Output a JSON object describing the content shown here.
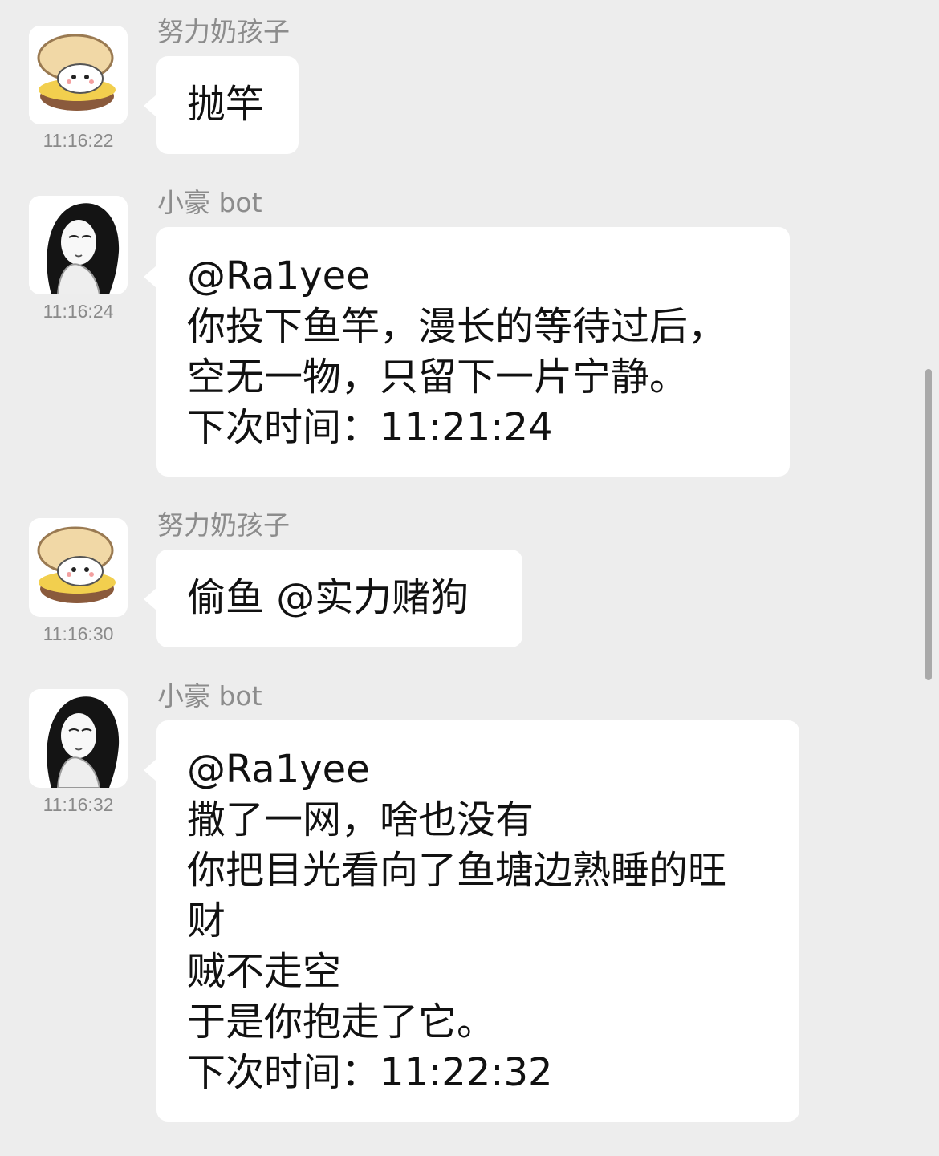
{
  "colors": {
    "background": "#ededed",
    "bubble": "#ffffff",
    "sender_text": "#8c8c8c",
    "time_text": "#8a8a8a",
    "message_text": "#111111",
    "scrollbar": "#a9a9a9"
  },
  "messages": [
    {
      "sender": "努力奶孩子",
      "time": "11:16:22",
      "avatar_icon": "cartoon-bread-cat-avatar-icon",
      "lines": [
        "抛竿"
      ]
    },
    {
      "sender": "小豪 bot",
      "time": "11:16:24",
      "avatar_icon": "sketch-girl-avatar-icon",
      "lines": [
        "@Ra1yee",
        "你投下鱼竿，漫长的等待过后，",
        "空无一物，只留下一片宁静。",
        "下次时间：11:21:24"
      ]
    },
    {
      "sender": "努力奶孩子",
      "time": "11:16:30",
      "avatar_icon": "cartoon-bread-cat-avatar-icon",
      "lines": [
        "偷鱼 @实力赌狗"
      ]
    },
    {
      "sender": "小豪 bot",
      "time": "11:16:32",
      "avatar_icon": "sketch-girl-avatar-icon",
      "lines": [
        "@Ra1yee",
        "撒了一网，啥也没有",
        "你把目光看向了鱼塘边熟睡的旺",
        "财",
        "贼不走空",
        "于是你抱走了它。",
        "下次时间：11:22:32"
      ]
    }
  ]
}
